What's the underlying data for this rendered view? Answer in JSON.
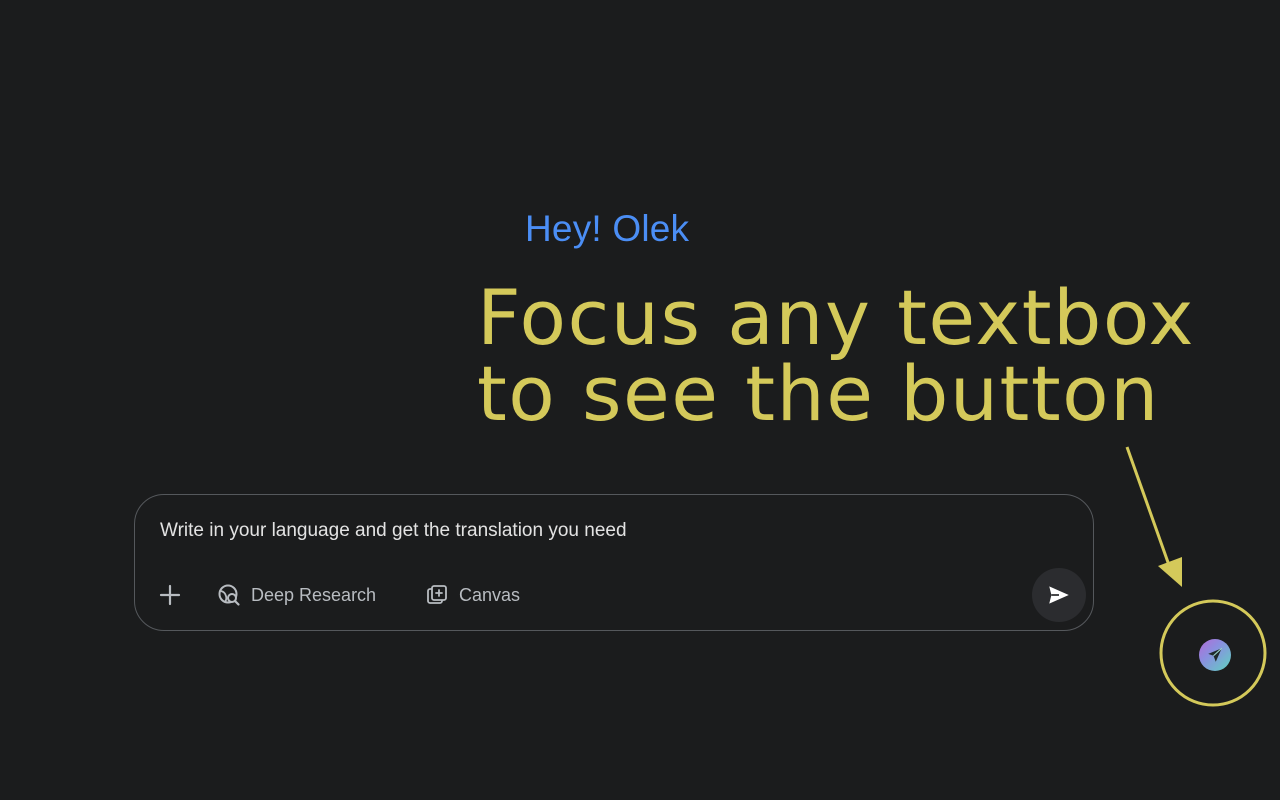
{
  "greeting": "Hey! Olek",
  "annotation": {
    "line1": "Focus any textbox",
    "line2": "to see the button"
  },
  "composer": {
    "input_value": "Write in your language and get the translation you need",
    "tools": {
      "deep_research_label": "Deep Research",
      "canvas_label": "Canvas"
    }
  },
  "icons": {
    "plus": "plus-icon",
    "deep_research": "globe-search-icon",
    "canvas": "canvas-add-icon",
    "send": "send-arrow-icon",
    "extension": "paper-plane-icon",
    "annotation_arrow": "arrow-down-icon"
  },
  "colors": {
    "background": "#1b1c1d",
    "greeting": "#4b8ef5",
    "annotation": "#d4c95a",
    "composer_border": "#55585c",
    "muted_text": "#b8bcc1"
  }
}
